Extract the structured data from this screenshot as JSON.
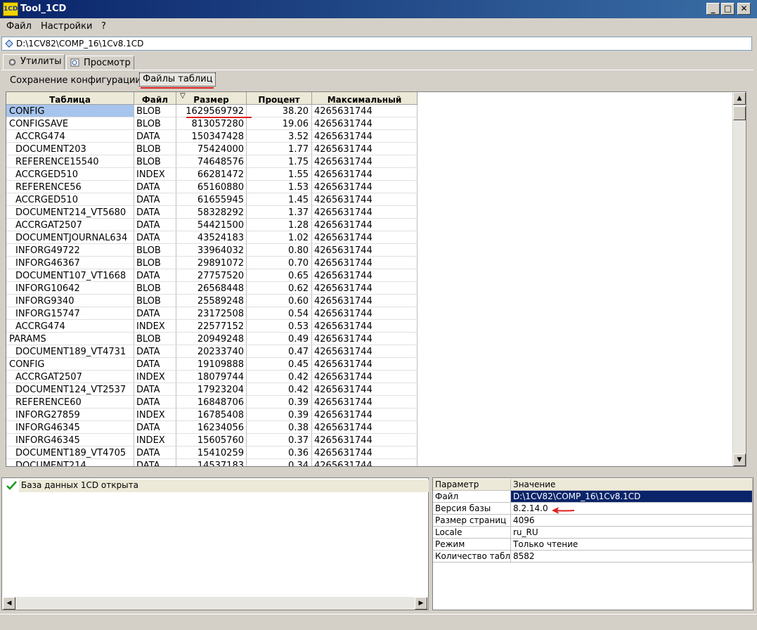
{
  "window": {
    "title": "Tool_1CD",
    "icon_text": "1CD",
    "minimize": "_",
    "maximize": "□",
    "close": "✕"
  },
  "menu": [
    "Файл",
    "Настройки",
    "?"
  ],
  "path_bar": {
    "value": "D:\\1CV82\\COMP_16\\1Cv8.1CD"
  },
  "main_tabs": [
    {
      "label": "Утилиты",
      "active": true
    },
    {
      "label": "Просмотр",
      "active": false
    }
  ],
  "sub_tabs": [
    {
      "label": "Сохранение конфигурации",
      "active": false
    },
    {
      "label": "Файлы таблиц",
      "active": true
    }
  ],
  "table": {
    "columns": [
      "Таблица",
      "Файл",
      "Размер",
      "Процент",
      "Максимальный"
    ],
    "sort_indicator": "▽",
    "rows": [
      [
        "CONFIG",
        "BLOB",
        "1629569792",
        "38.20",
        "4265631744"
      ],
      [
        "CONFIGSAVE",
        "BLOB",
        "813057280",
        "19.06",
        "4265631744"
      ],
      [
        "ACCRG474",
        "DATA",
        "150347428",
        "3.52",
        "4265631744"
      ],
      [
        "DOCUMENT203",
        "BLOB",
        "75424000",
        "1.77",
        "4265631744"
      ],
      [
        "REFERENCE15540",
        "BLOB",
        "74648576",
        "1.75",
        "4265631744"
      ],
      [
        "ACCRGED510",
        "INDEX",
        "66281472",
        "1.55",
        "4265631744"
      ],
      [
        "REFERENCE56",
        "DATA",
        "65160880",
        "1.53",
        "4265631744"
      ],
      [
        "ACCRGED510",
        "DATA",
        "61655945",
        "1.45",
        "4265631744"
      ],
      [
        "DOCUMENT214_VT5680",
        "DATA",
        "58328292",
        "1.37",
        "4265631744"
      ],
      [
        "ACCRGAT2507",
        "DATA",
        "54421500",
        "1.28",
        "4265631744"
      ],
      [
        "DOCUMENTJOURNAL634",
        "DATA",
        "43524183",
        "1.02",
        "4265631744"
      ],
      [
        "INFORG49722",
        "BLOB",
        "33964032",
        "0.80",
        "4265631744"
      ],
      [
        "INFORG46367",
        "BLOB",
        "29891072",
        "0.70",
        "4265631744"
      ],
      [
        "DOCUMENT107_VT1668",
        "DATA",
        "27757520",
        "0.65",
        "4265631744"
      ],
      [
        "INFORG10642",
        "BLOB",
        "26568448",
        "0.62",
        "4265631744"
      ],
      [
        "INFORG9340",
        "BLOB",
        "25589248",
        "0.60",
        "4265631744"
      ],
      [
        "INFORG15747",
        "DATA",
        "23172508",
        "0.54",
        "4265631744"
      ],
      [
        "ACCRG474",
        "INDEX",
        "22577152",
        "0.53",
        "4265631744"
      ],
      [
        "PARAMS",
        "BLOB",
        "20949248",
        "0.49",
        "4265631744"
      ],
      [
        "DOCUMENT189_VT4731",
        "DATA",
        "20233740",
        "0.47",
        "4265631744"
      ],
      [
        "CONFIG",
        "DATA",
        "19109888",
        "0.45",
        "4265631744"
      ],
      [
        "ACCRGAT2507",
        "INDEX",
        "18079744",
        "0.42",
        "4265631744"
      ],
      [
        "DOCUMENT124_VT2537",
        "DATA",
        "17923204",
        "0.42",
        "4265631744"
      ],
      [
        "REFERENCE60",
        "DATA",
        "16848706",
        "0.39",
        "4265631744"
      ],
      [
        "INFORG27859",
        "INDEX",
        "16785408",
        "0.39",
        "4265631744"
      ],
      [
        "INFORG46345",
        "DATA",
        "16234056",
        "0.38",
        "4265631744"
      ],
      [
        "INFORG46345",
        "INDEX",
        "15605760",
        "0.37",
        "4265631744"
      ],
      [
        "DOCUMENT189_VT4705",
        "DATA",
        "15410259",
        "0.36",
        "4265631744"
      ],
      [
        "DOCUMENT214",
        "DATA",
        "14537183",
        "0.34",
        "4265631744"
      ]
    ],
    "indent": [
      false,
      false,
      true,
      true,
      true,
      true,
      true,
      true,
      true,
      true,
      true,
      true,
      true,
      true,
      true,
      true,
      true,
      true,
      false,
      true,
      false,
      true,
      true,
      true,
      true,
      true,
      true,
      true,
      true
    ]
  },
  "log": {
    "message": "База данных 1CD открыта"
  },
  "props": {
    "columns": [
      "Параметр",
      "Значение"
    ],
    "rows": [
      [
        "Файл",
        "D:\\1CV82\\COMP_16\\1Cv8.1CD"
      ],
      [
        "Версия базы",
        "8.2.14.0"
      ],
      [
        "Размер страниц",
        "4096"
      ],
      [
        "Locale",
        "ru_RU"
      ],
      [
        "Режим",
        "Только чтение"
      ],
      [
        "Количество таблиц",
        "8582"
      ]
    ]
  },
  "colors": {
    "selection": "#0a246a",
    "row_selected": "#a6c4ec",
    "annotation": "#e02020"
  }
}
